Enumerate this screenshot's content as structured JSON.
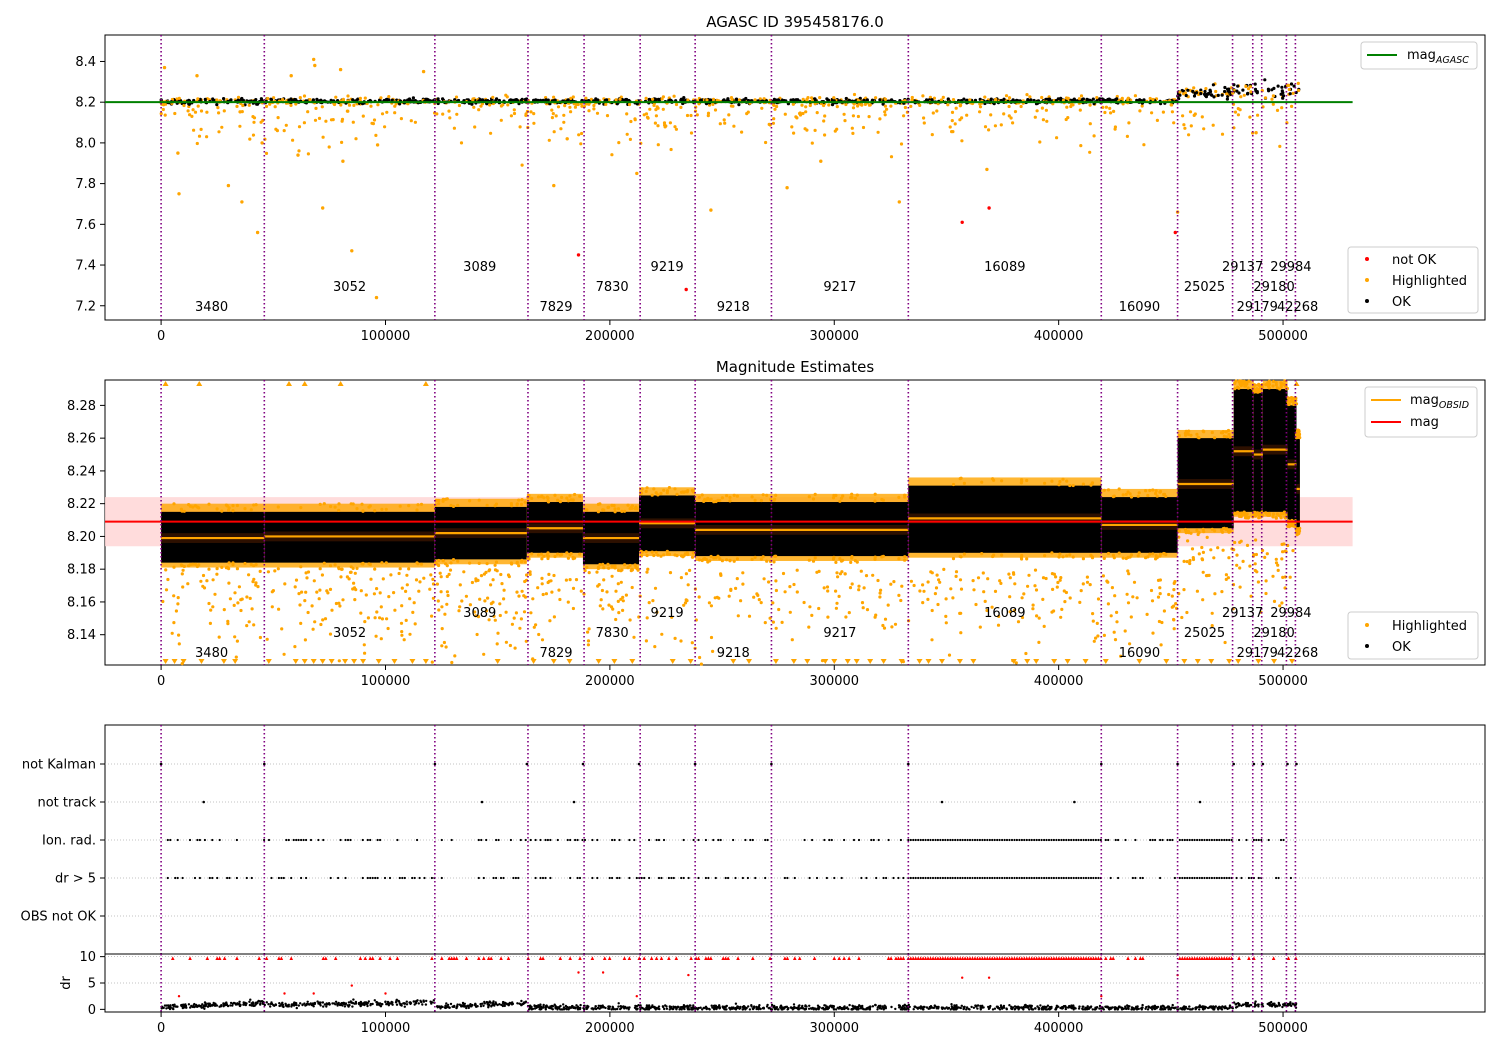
{
  "colors": {
    "ok": "#000000",
    "highlighted": "#ffa500",
    "not_ok": "#ff0000",
    "obsid_line": "#800080",
    "mag_agasc": "#008000",
    "mag": "#ff0000",
    "mag_obsid": "#ffa500",
    "mag_band": "#ffd6d6",
    "flag_grid": "#b0b0b0"
  },
  "chart_data": [
    {
      "type": "scatter",
      "title": "AGASC ID 395458176.0",
      "xlim": [
        -25000,
        590000
      ],
      "ylim": [
        7.13,
        8.53
      ],
      "xticks": [
        0,
        100000,
        200000,
        300000,
        400000,
        500000
      ],
      "yticks": [
        7.2,
        7.4,
        7.6,
        7.8,
        8.0,
        8.2,
        8.4
      ],
      "ytick_labels": [
        "7.2",
        "7.4",
        "7.6",
        "7.8",
        "8.0",
        "8.2",
        "8.4"
      ],
      "mag_agasc": 8.2,
      "legend_lines": [
        {
          "label_main": "mag",
          "label_sub": "AGASC",
          "color": "#008000"
        }
      ],
      "legend_points": [
        {
          "label": "not OK",
          "color": "#ff0000"
        },
        {
          "label": "Highlighted",
          "color": "#ffa500"
        },
        {
          "label": "OK",
          "color": "#000000"
        }
      ],
      "outliers_highlighted": [
        [
          1500,
          8.37
        ],
        [
          7500,
          7.95
        ],
        [
          8000,
          7.75
        ],
        [
          16000,
          8.33
        ],
        [
          30000,
          7.79
        ],
        [
          36000,
          7.71
        ],
        [
          43000,
          7.56
        ],
        [
          45000,
          8.0
        ],
        [
          58000,
          8.33
        ],
        [
          61000,
          7.94
        ],
        [
          68000,
          8.41
        ],
        [
          68500,
          8.38
        ],
        [
          72000,
          7.68
        ],
        [
          80000,
          8.36
        ],
        [
          81000,
          7.91
        ],
        [
          85000,
          7.47
        ],
        [
          96000,
          7.24
        ],
        [
          96500,
          7.99
        ],
        [
          117000,
          8.35
        ],
        [
          175000,
          7.79
        ],
        [
          181000,
          8.02
        ],
        [
          212000,
          7.85
        ],
        [
          245000,
          7.67
        ],
        [
          279000,
          7.78
        ],
        [
          294000,
          7.91
        ],
        [
          329000,
          7.71
        ],
        [
          368000,
          7.87
        ],
        [
          453000,
          7.66
        ],
        [
          488000,
          8.05
        ]
      ],
      "outliers_not_ok": [
        [
          186000,
          7.45
        ],
        [
          234000,
          7.28
        ],
        [
          357000,
          7.61
        ],
        [
          369000,
          7.68
        ],
        [
          452000,
          7.56
        ]
      ]
    },
    {
      "type": "scatter",
      "title": "Magnitude Estimates",
      "xlim": [
        -25000,
        590000
      ],
      "ylim": [
        8.1215,
        8.2955
      ],
      "xticks": [
        0,
        100000,
        200000,
        300000,
        400000,
        500000
      ],
      "yticks": [
        8.14,
        8.16,
        8.18,
        8.2,
        8.22,
        8.24,
        8.26,
        8.28
      ],
      "ytick_labels": [
        "8.14",
        "8.16",
        "8.18",
        "8.20",
        "8.22",
        "8.24",
        "8.26",
        "8.28"
      ],
      "mag": 8.209,
      "mag_band": [
        8.194,
        8.224
      ],
      "legend_lines": [
        {
          "label_main": "mag",
          "label_sub": "OBSID",
          "color": "#ffa500"
        },
        {
          "label_main": "mag",
          "label_sub": "",
          "color": "#ff0000"
        }
      ],
      "legend_points": [
        {
          "label": "Highlighted",
          "color": "#ffa500"
        },
        {
          "label": "OK",
          "color": "#000000"
        }
      ],
      "obsid_segments": [
        {
          "x0": 0,
          "x1": 46000,
          "mean": 8.199,
          "lo": 8.184,
          "hi": 8.215
        },
        {
          "x0": 46000,
          "x1": 122000,
          "mean": 8.2,
          "lo": 8.184,
          "hi": 8.215
        },
        {
          "x0": 122000,
          "x1": 163000,
          "mean": 8.202,
          "lo": 8.186,
          "hi": 8.218
        },
        {
          "x0": 163000,
          "x1": 188000,
          "mean": 8.205,
          "lo": 8.19,
          "hi": 8.221
        },
        {
          "x0": 188000,
          "x1": 213000,
          "mean": 8.199,
          "lo": 8.183,
          "hi": 8.215
        },
        {
          "x0": 213000,
          "x1": 238000,
          "mean": 8.208,
          "lo": 8.191,
          "hi": 8.225
        },
        {
          "x0": 238000,
          "x1": 272000,
          "mean": 8.204,
          "lo": 8.188,
          "hi": 8.221
        },
        {
          "x0": 272000,
          "x1": 333000,
          "mean": 8.204,
          "lo": 8.188,
          "hi": 8.221
        },
        {
          "x0": 333000,
          "x1": 419000,
          "mean": 8.211,
          "lo": 8.19,
          "hi": 8.231
        },
        {
          "x0": 419000,
          "x1": 453000,
          "mean": 8.207,
          "lo": 8.19,
          "hi": 8.224
        },
        {
          "x0": 453000,
          "x1": 478000,
          "mean": 8.232,
          "lo": 8.205,
          "hi": 8.26
        },
        {
          "x0": 478000,
          "x1": 487000,
          "mean": 8.252,
          "lo": 8.215,
          "hi": 8.29
        },
        {
          "x0": 487000,
          "x1": 491000,
          "mean": 8.25,
          "lo": 8.215,
          "hi": 8.288
        },
        {
          "x0": 491000,
          "x1": 502000,
          "mean": 8.253,
          "lo": 8.215,
          "hi": 8.29
        },
        {
          "x0": 502000,
          "x1": 506000,
          "mean": 8.244,
          "lo": 8.21,
          "hi": 8.28
        },
        {
          "x0": 506000,
          "x1": 507500,
          "mean": 8.229,
          "lo": 8.205,
          "hi": 8.26
        }
      ],
      "clipped_low_x": [
        2000,
        6000,
        10000,
        18000,
        28000,
        33000,
        48000,
        60000,
        64000,
        68000,
        72000,
        76000,
        82000,
        86000,
        90000,
        97000,
        104000,
        112000,
        118000,
        150000,
        166000,
        175000,
        182000,
        195000,
        202000,
        210000,
        228000,
        236000,
        255000,
        262000,
        274000,
        282000,
        288000,
        296000,
        300000,
        306000,
        310000,
        316000,
        322000,
        330000,
        338000,
        342000,
        348000,
        356000,
        362000,
        380000,
        386000,
        390000,
        398000,
        404000,
        412000,
        421000,
        436000,
        448000,
        456000,
        462000,
        468000,
        476000,
        480000,
        489000,
        496000,
        504000
      ],
      "clipped_high_x": [
        2000,
        17000,
        57000,
        64000,
        80000,
        118000,
        506000
      ]
    },
    {
      "type": "scatter",
      "title": "",
      "xlim": [
        -25000,
        590000
      ],
      "flag_labels": [
        "not Kalman",
        "not track",
        "Ion. rad.",
        "dr > 5",
        "OBS not OK"
      ],
      "flag_points": {
        "not Kalman": [
          0,
          46000,
          122000,
          163000,
          188000,
          213000,
          238000,
          272000,
          333000,
          419000,
          453000,
          478000,
          487000,
          491000,
          502000,
          506000
        ],
        "not track": [
          19000,
          143000,
          184000,
          348000,
          407000,
          463000
        ]
      },
      "dr_ylim": [
        -0.5,
        10.5
      ],
      "dr_yticks": [
        0,
        5,
        10
      ],
      "dr_ylabel": "dr",
      "dr_outliers": [
        [
          8000,
          2.5
        ],
        [
          55000,
          3
        ],
        [
          68000,
          3
        ],
        [
          85000,
          4.5
        ],
        [
          100000,
          3
        ],
        [
          186000,
          7
        ],
        [
          197000,
          7
        ],
        [
          212000,
          2.5
        ],
        [
          235000,
          6.5
        ],
        [
          357000,
          6
        ],
        [
          369000,
          6
        ],
        [
          453000,
          6.5
        ],
        [
          419000,
          2.5
        ]
      ]
    }
  ],
  "obsid_boundaries": [
    0,
    46000,
    122000,
    163500,
    188500,
    213500,
    238000,
    272000,
    333000,
    419000,
    453000,
    477500,
    486500,
    490500,
    501500,
    505500
  ],
  "obsid_labels": [
    {
      "text": "3480",
      "x": 22500,
      "row": 0
    },
    {
      "text": "3052",
      "x": 84000,
      "row": 1
    },
    {
      "text": "3089",
      "x": 142000,
      "row": 2
    },
    {
      "text": "7829",
      "x": 176000,
      "row": 0
    },
    {
      "text": "7830",
      "x": 201000,
      "row": 1
    },
    {
      "text": "9219",
      "x": 225500,
      "row": 2
    },
    {
      "text": "9218",
      "x": 255000,
      "row": 0
    },
    {
      "text": "9217",
      "x": 302500,
      "row": 1
    },
    {
      "text": "16089",
      "x": 376000,
      "row": 2
    },
    {
      "text": "16090",
      "x": 436000,
      "row": 0
    },
    {
      "text": "25025",
      "x": 465000,
      "row": 1
    },
    {
      "text": "29137",
      "x": 482000,
      "row": 2
    },
    {
      "text": "29179",
      "x": 488500,
      "row": 0
    },
    {
      "text": "29180",
      "x": 496000,
      "row": 1
    },
    {
      "text": "29984",
      "x": 503500,
      "row": 2
    },
    {
      "text": "42268",
      "x": 506500,
      "row": 0
    }
  ]
}
